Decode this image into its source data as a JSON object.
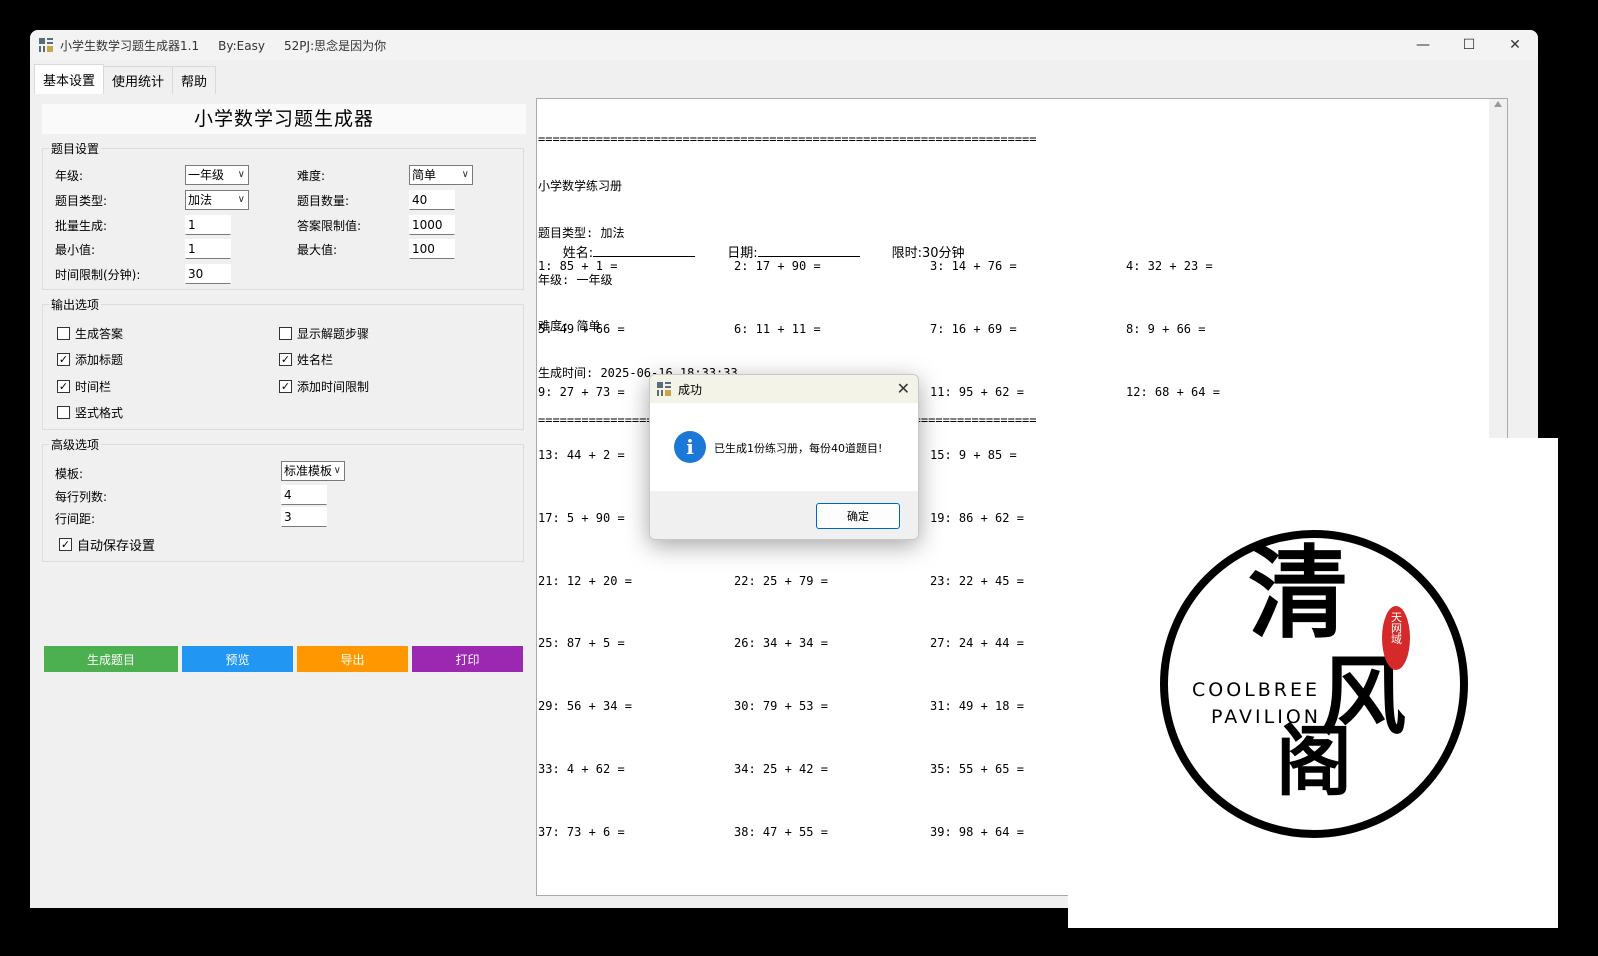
{
  "window": {
    "title": "小学生数学习题生成器1.1     By:Easy     52PJ:思念是因为你",
    "minimize_label": "—",
    "maximize_label": "☐",
    "close_label": "✕"
  },
  "tabs": [
    {
      "label": "基本设置",
      "active": true
    },
    {
      "label": "使用统计",
      "active": false
    },
    {
      "label": "帮助",
      "active": false
    }
  ],
  "header": {
    "title": "小学数学习题生成器"
  },
  "question_settings": {
    "group_label": "题目设置",
    "grade_label": "年级:",
    "grade_value": "一年级",
    "difficulty_label": "难度:",
    "difficulty_value": "简单",
    "type_label": "题目类型:",
    "type_value": "加法",
    "count_label": "题目数量:",
    "count_value": "40",
    "batch_label": "批量生成:",
    "batch_value": "1",
    "answer_limit_label": "答案限制值:",
    "answer_limit_value": "1000",
    "min_label": "最小值:",
    "min_value": "1",
    "max_label": "最大值:",
    "max_value": "100",
    "time_limit_label": "时间限制(分钟):",
    "time_limit_value": "30"
  },
  "output_options": {
    "group_label": "输出选项",
    "generate_answers": {
      "label": "生成答案",
      "checked": false
    },
    "show_steps": {
      "label": "显示解题步骤",
      "checked": false
    },
    "add_title": {
      "label": "添加标题",
      "checked": true
    },
    "name_field": {
      "label": "姓名栏",
      "checked": true
    },
    "time_field": {
      "label": "时间栏",
      "checked": true
    },
    "add_time_limit": {
      "label": "添加时间限制",
      "checked": true
    },
    "vertical_format": {
      "label": "竖式格式",
      "checked": false
    }
  },
  "advanced": {
    "group_label": "高级选项",
    "template_label": "模板:",
    "template_value": "标准模板",
    "columns_label": "每行列数:",
    "columns_value": "4",
    "spacing_label": "行间距:",
    "spacing_value": "3",
    "autosave": {
      "label": "自动保存设置",
      "checked": true
    }
  },
  "buttons": {
    "generate": "生成题目",
    "preview": "预览",
    "export": "导出",
    "print": "打印"
  },
  "colors": {
    "generate": "#4caf50",
    "preview": "#2196f3",
    "export": "#ff9800",
    "print": "#9c27b0"
  },
  "output": {
    "separator": "=====================================================================",
    "header_lines": [
      "小学数学练习册",
      "题目类型: 加法",
      "年级: 一年级",
      "难度: 简单",
      "生成时间: 2025-06-16 18:33:33"
    ],
    "name_label": "姓名:",
    "date_label": "日期:",
    "time_limit_text": "限时:30分钟",
    "questions": [
      "1: 85 + 1 =",
      "2: 17 + 90 =",
      "3: 14 + 76 =",
      "4: 32 + 23 =",
      "5: 49 + 66 =",
      "6: 11 + 11 =",
      "7: 16 + 69 =",
      "8: 9 + 66 =",
      "9: 27 + 73 =",
      "",
      "11: 95 + 62 =",
      "12: 68 + 64 =",
      "13: 44 + 2 =",
      "",
      "15: 9 + 85 =",
      "",
      "17: 5 + 90 =",
      "",
      "19: 86 + 62 =",
      "",
      "21: 12 + 20 =",
      "22: 25 + 79 =",
      "23: 22 + 45 =",
      "",
      "25: 87 + 5 =",
      "26: 34 + 34 =",
      "27: 24 + 44 =",
      "",
      "29: 56 + 34 =",
      "30: 79 + 53 =",
      "31: 49 + 18 =",
      "",
      "33: 4 + 62 =",
      "34: 25 + 42 =",
      "35: 55 + 65 =",
      "",
      "37: 73 + 6 =",
      "38: 47 + 55 =",
      "39: 98 + 64 =",
      ""
    ]
  },
  "dialog": {
    "title": "成功",
    "message": "已生成1份练习册，每份40道题目!",
    "ok_label": "确定",
    "close_label": "✕",
    "icon_glyph": "i"
  },
  "watermark": {
    "char1": "清",
    "char2": "风",
    "char3": "阁",
    "line1": "COOLBREE",
    "line2": "PAVILION",
    "seal": "天网域"
  }
}
